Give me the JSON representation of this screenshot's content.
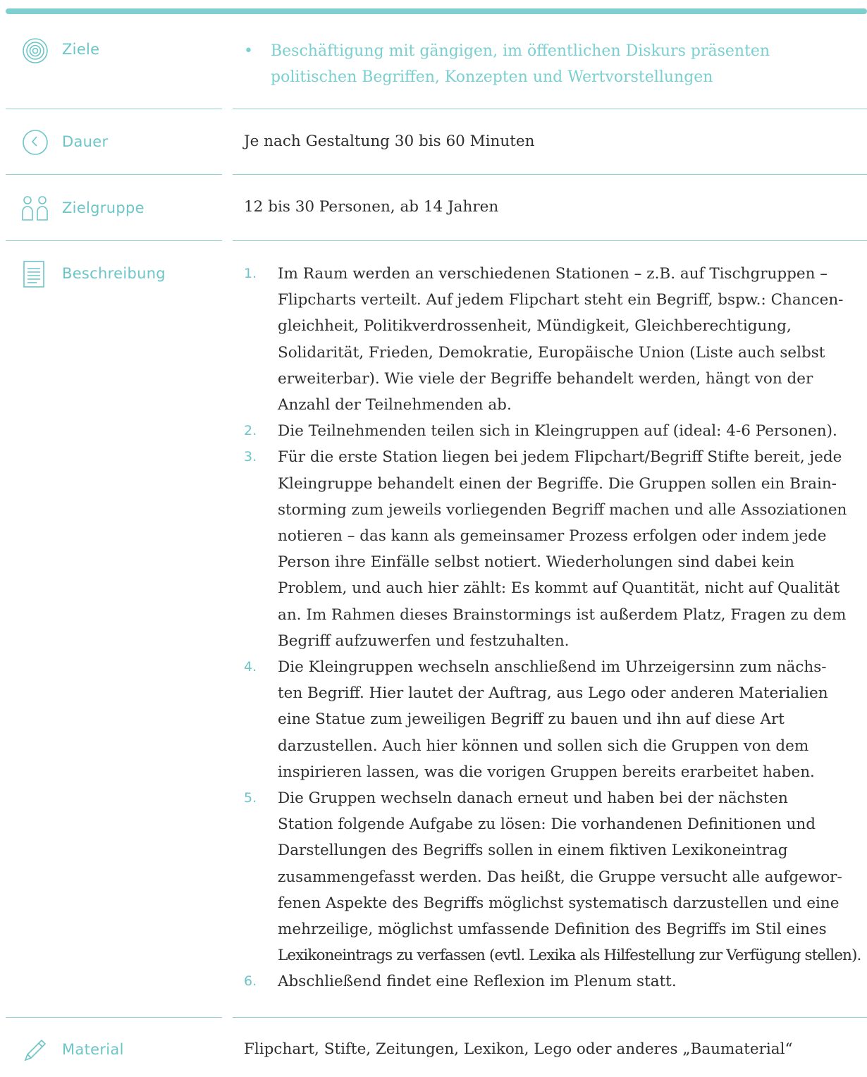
{
  "sections": {
    "ziele": {
      "label": "Ziele",
      "icon": "target-icon",
      "items": [
        "Beschäftigung mit gängigen, im öffentlichen Diskurs präsenten politischen Begriffen, Konzepten und Wertvorstellungen"
      ]
    },
    "dauer": {
      "label": "Dauer",
      "icon": "clock-icon",
      "text": "Je nach Gestaltung 30 bis 60 Minuten"
    },
    "zielgruppe": {
      "label": "Zielgruppe",
      "icon": "people-icon",
      "text": "12 bis 30 Personen, ab 14 Jahren"
    },
    "beschreibung": {
      "label": "Beschreibung",
      "icon": "document-icon",
      "steps": [
        {
          "num": "1.",
          "lines": [
            "Im Raum werden an verschiedenen Stationen – z.B. auf Tischgruppen –",
            "Flipcharts verteilt. Auf jedem Flipchart steht ein Begriff, bspw.: Chancen-",
            "gleichheit, Politikverdrossenheit, Mündigkeit, Gleichberechtigung,",
            "Solidarität, Frieden, Demokratie, Europäische Union (Liste auch selbst",
            "erweiterbar). Wie viele der Begriffe behandelt werden, hängt von der",
            "Anzahl der Teilnehmenden ab."
          ]
        },
        {
          "num": "2.",
          "lines": [
            "Die Teilnehmenden teilen sich in Kleingruppen auf (ideal: 4-6 Personen)."
          ]
        },
        {
          "num": "3.",
          "lines": [
            "Für die erste Station liegen bei jedem Flipchart/Begriff Stifte bereit, jede",
            "Kleingruppe behandelt einen der Begriffe. Die Gruppen sollen ein Brain-",
            "storming zum jeweils vorliegenden Begriff machen und alle Assoziationen",
            "notieren – das kann als gemeinsamer Prozess erfolgen oder indem jede",
            "Person ihre Einfälle selbst notiert. Wiederholungen sind dabei kein",
            "Problem, und auch hier zählt: Es kommt auf Quantität, nicht auf Qualität",
            "an. Im Rahmen dieses Brainstormings ist außerdem Platz, Fragen zu dem",
            "Begriff aufzuwerfen und festzuhalten."
          ]
        },
        {
          "num": "4.",
          "lines": [
            "Die Kleingruppen wechseln anschließend im Uhrzeigersinn zum nächs-",
            "ten Begriff. Hier lautet der Auftrag, aus Lego oder anderen Materialien",
            "eine Statue zum jeweiligen Begriff zu bauen und ihn auf diese Art",
            "darzustellen. Auch hier können und sollen sich die Gruppen von dem",
            "inspirieren lassen, was die vorigen Gruppen bereits erarbeitet haben."
          ]
        },
        {
          "num": "5.",
          "lines": [
            "Die Gruppen wechseln danach erneut und haben bei der nächsten",
            "Station folgende Aufgabe zu lösen: Die vorhandenen Definitionen und",
            "Darstellungen des Begriffs sollen in einem fiktiven Lexikoneintrag",
            "zusammengefasst werden. Das heißt, die Gruppe versucht alle aufgewor-",
            "fenen Aspekte des Begriffs möglichst systematisch darzustellen und eine",
            "mehrzeilige, möglichst umfassende Definition des Begriffs im Stil eines",
            "Lexikoneintrags zu verfassen (evtl. Lexika als Hilfestellung zur Verfügung stellen)."
          ]
        },
        {
          "num": "6.",
          "lines": [
            "Abschließend findet eine Reflexion im Plenum statt."
          ]
        }
      ]
    },
    "material": {
      "label": "Material",
      "icon": "pencil-icon",
      "text": "Flipchart, Stifte, Zeitungen, Lexikon, Lego oder anderes „Baumaterial“"
    }
  },
  "colors": {
    "accent": "#6cc5c8",
    "bar": "#7fcfcf",
    "rule": "#8fd2d2",
    "text": "#2e2e2e"
  }
}
